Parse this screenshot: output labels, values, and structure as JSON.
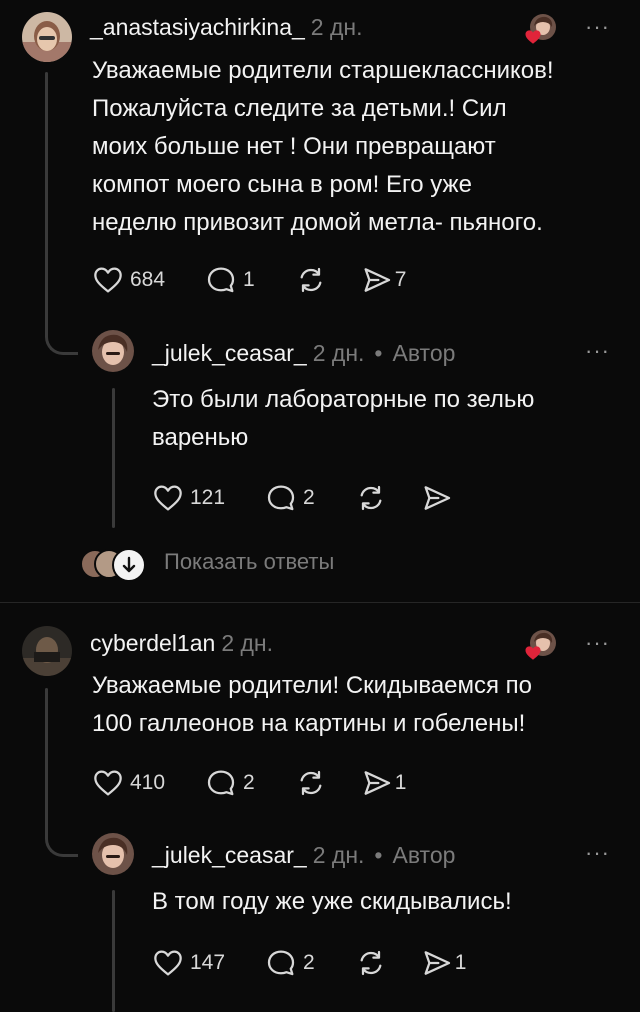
{
  "comments": [
    {
      "username": "_anastasiyachirkina_",
      "time": "2 дн.",
      "text_lines": [
        "Уважаемые родители старшеклассников!",
        "Пожалуйста следите за детьми.! Сил",
        "моих больше нет ! Они превращают",
        "компот моего сына в ром! Его уже",
        "неделю привозит домой метла- пьяного."
      ],
      "likes": "684",
      "replies": "1",
      "reposts": "",
      "shares": "7",
      "reply": {
        "username": "_julek_ceasar_",
        "time": "2 дн.",
        "sep": "•",
        "author": "Автор",
        "text_lines": [
          "Это были лабораторные по зелью",
          "варенью"
        ],
        "likes": "121",
        "replies": "2",
        "reposts": "",
        "shares": ""
      },
      "show_replies": "Показать ответы"
    },
    {
      "username": "cyberdel1an",
      "time": "2 дн.",
      "text_lines": [
        "Уважаемые родители! Скидываемся по",
        "100 галлеонов на картины и гобелены!"
      ],
      "likes": "410",
      "replies": "2",
      "reposts": "",
      "shares": "1",
      "reply": {
        "username": "_julek_ceasar_",
        "time": "2 дн.",
        "sep": "•",
        "author": "Автор",
        "text_lines": [
          "В том году же уже скидывались!"
        ],
        "likes": "147",
        "replies": "2",
        "reposts": "",
        "shares": "1"
      }
    }
  ],
  "icons": {
    "like": "heart-icon",
    "reply": "speech-bubble-icon",
    "repost": "repost-icon",
    "share": "send-icon",
    "more": "more-dots-icon",
    "expand": "arrow-down-icon"
  },
  "more_glyph": "···",
  "colors": {
    "background": "#0a0a0a",
    "text": "#f3f3f3",
    "muted": "#7b7b7b",
    "like_red": "#e0243a"
  }
}
